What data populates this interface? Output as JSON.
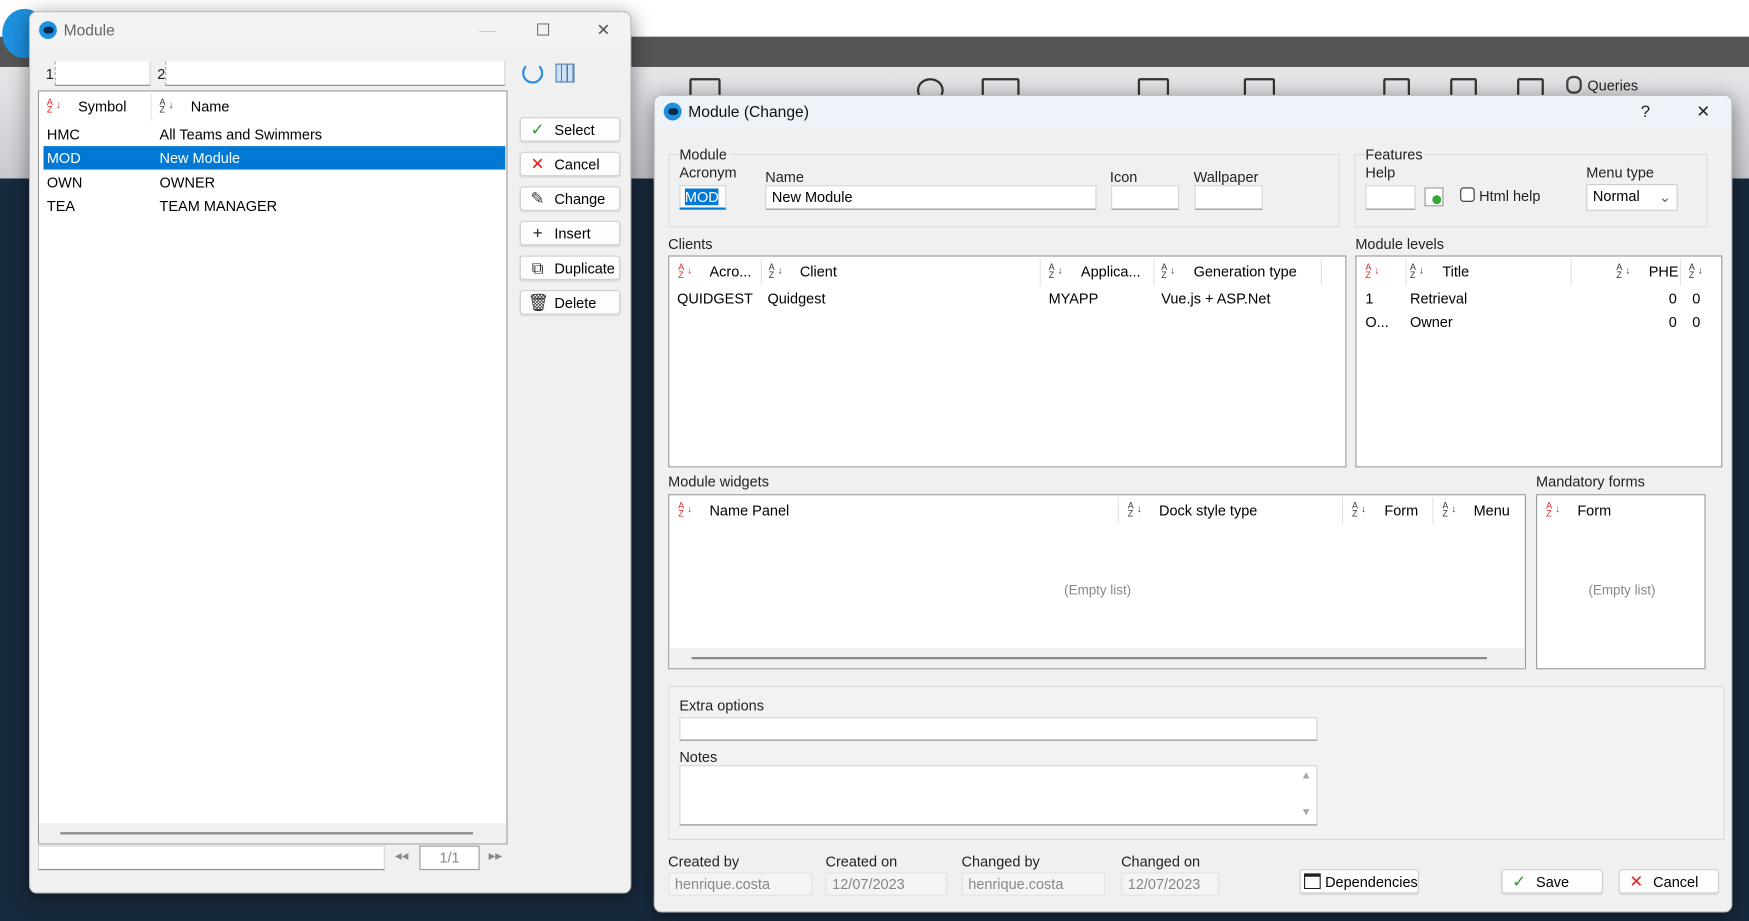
{
  "background": {
    "ribbon_label": "Queries"
  },
  "list_window": {
    "title": "Module",
    "filters": [
      {
        "label": "1",
        "value": ""
      },
      {
        "label": "2",
        "value": ""
      }
    ],
    "icons": [
      "refresh-icon",
      "grid-settings-icon"
    ],
    "columns": [
      "Symbol",
      "Name"
    ],
    "rows": [
      {
        "symbol": "HMC",
        "name": "All Teams and Swimmers",
        "selected": false
      },
      {
        "symbol": "MOD",
        "name": "New Module",
        "selected": true
      },
      {
        "symbol": "OWN",
        "name": "OWNER",
        "selected": false
      },
      {
        "symbol": "TEA",
        "name": "TEAM MANAGER",
        "selected": false
      }
    ],
    "buttons": {
      "select": "Select",
      "cancel": "Cancel",
      "change": "Change",
      "insert": "Insert",
      "duplicate": "Duplicate",
      "delete": "Delete"
    },
    "search_value": "",
    "page": "1/1"
  },
  "dialog": {
    "title": "Module (Change)",
    "help": "?",
    "module_group": {
      "legend": "Module",
      "acronym_label": "Acronym",
      "acronym": "MOD",
      "name_label": "Name",
      "name": "New Module",
      "icon_label": "Icon",
      "icon": "",
      "wallpaper_label": "Wallpaper",
      "wallpaper": ""
    },
    "features_group": {
      "legend": "Features",
      "help_label": "Help",
      "help": "",
      "html_help_label": "Html help",
      "html_help_checked": false,
      "menu_type_label": "Menu type",
      "menu_type": "Normal"
    },
    "clients": {
      "label": "Clients",
      "columns": [
        "Acro...",
        "Client",
        "Applica...",
        "Generation type"
      ],
      "rows": [
        [
          "QUIDGEST",
          "Quidgest",
          "MYAPP",
          "Vue.js + ASP.Net"
        ]
      ]
    },
    "module_levels": {
      "label": "Module levels",
      "columns": [
        "",
        "Title",
        "PHE",
        ""
      ],
      "rows": [
        [
          "1",
          "Retrieval",
          "0",
          "0"
        ],
        [
          "O...",
          "Owner",
          "0",
          "0"
        ]
      ]
    },
    "module_widgets": {
      "label": "Module widgets",
      "columns": [
        "Name Panel",
        "Dock style type",
        "Form",
        "Menu"
      ],
      "empty": "(Empty list)"
    },
    "mandatory_forms": {
      "label": "Mandatory forms",
      "columns": [
        "Form"
      ],
      "empty": "(Empty list)"
    },
    "extra_options": {
      "label": "Extra options",
      "value": ""
    },
    "notes": {
      "label": "Notes",
      "value": ""
    },
    "audit": {
      "created_by_label": "Created by",
      "created_by": "henrique.costa",
      "created_on_label": "Created on",
      "created_on": "12/07/2023",
      "changed_by_label": "Changed by",
      "changed_by": "henrique.costa",
      "changed_on_label": "Changed on",
      "changed_on": "12/07/2023"
    },
    "buttons": {
      "dependencies": "Dependencies",
      "save": "Save",
      "cancel": "Cancel"
    }
  },
  "colors": {
    "selection": "#0078d4",
    "sort_primary": "#e02020",
    "accent": "#1e90e0"
  }
}
